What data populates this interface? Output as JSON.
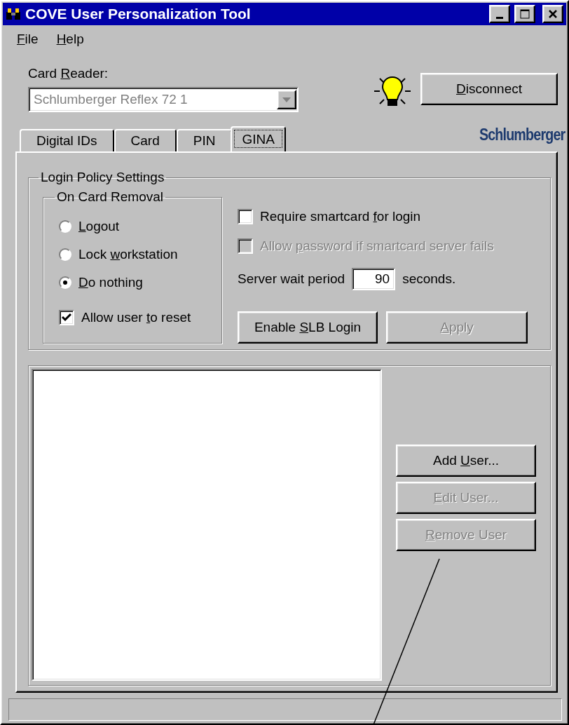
{
  "window": {
    "title": "COVE User Personalization Tool"
  },
  "menu": [
    {
      "key": "F",
      "post": "ile"
    },
    {
      "key": "H",
      "post": "elp"
    }
  ],
  "card_reader": {
    "label": {
      "pre": "Card ",
      "key": "R",
      "post": "eader:"
    },
    "value": "Schlumberger Reflex 72 1",
    "disabled": true
  },
  "status_light": {
    "on": true
  },
  "disconnect_button": {
    "key": "D",
    "post": "isconnect"
  },
  "logo": "Schlumberger",
  "tabs": [
    {
      "label": "Digital IDs",
      "selected": false
    },
    {
      "label": "Card",
      "selected": false
    },
    {
      "label": "PIN",
      "selected": false
    },
    {
      "label": "GINA",
      "selected": true
    }
  ],
  "login_policy": {
    "title": "Login Policy Settings",
    "on_card_removal": {
      "title": "On Card Removal",
      "options": [
        {
          "key": "L",
          "post": "ogout",
          "selected": false
        },
        {
          "pre": "Lock ",
          "key": "w",
          "post": "orkstation",
          "selected": false
        },
        {
          "key": "D",
          "post": "o nothing",
          "selected": true
        }
      ],
      "allow_reset": {
        "pre": "Allow user ",
        "key": "t",
        "post": "o reset",
        "checked": true
      }
    },
    "require_smartcard": {
      "pre": "Require smartcard ",
      "key": "f",
      "post": "or login",
      "checked": false,
      "disabled": false
    },
    "allow_password": {
      "pre": "Allow ",
      "key": "p",
      "post": "assword if smartcard server fails",
      "checked": false,
      "disabled": true
    },
    "server_wait": {
      "label": "Server wait period",
      "value": "90",
      "unit": "seconds."
    },
    "buttons": [
      {
        "pre": "Enable ",
        "key": "S",
        "post": "LB Login",
        "disabled": false
      },
      {
        "key": "A",
        "post": "pply",
        "disabled": true
      }
    ]
  },
  "user_buttons": [
    {
      "pre": "Add ",
      "key": "U",
      "post": "ser...",
      "disabled": false
    },
    {
      "key": "E",
      "post": "dit User...",
      "disabled": true
    },
    {
      "key": "R",
      "post": "emove User",
      "disabled": true
    }
  ]
}
